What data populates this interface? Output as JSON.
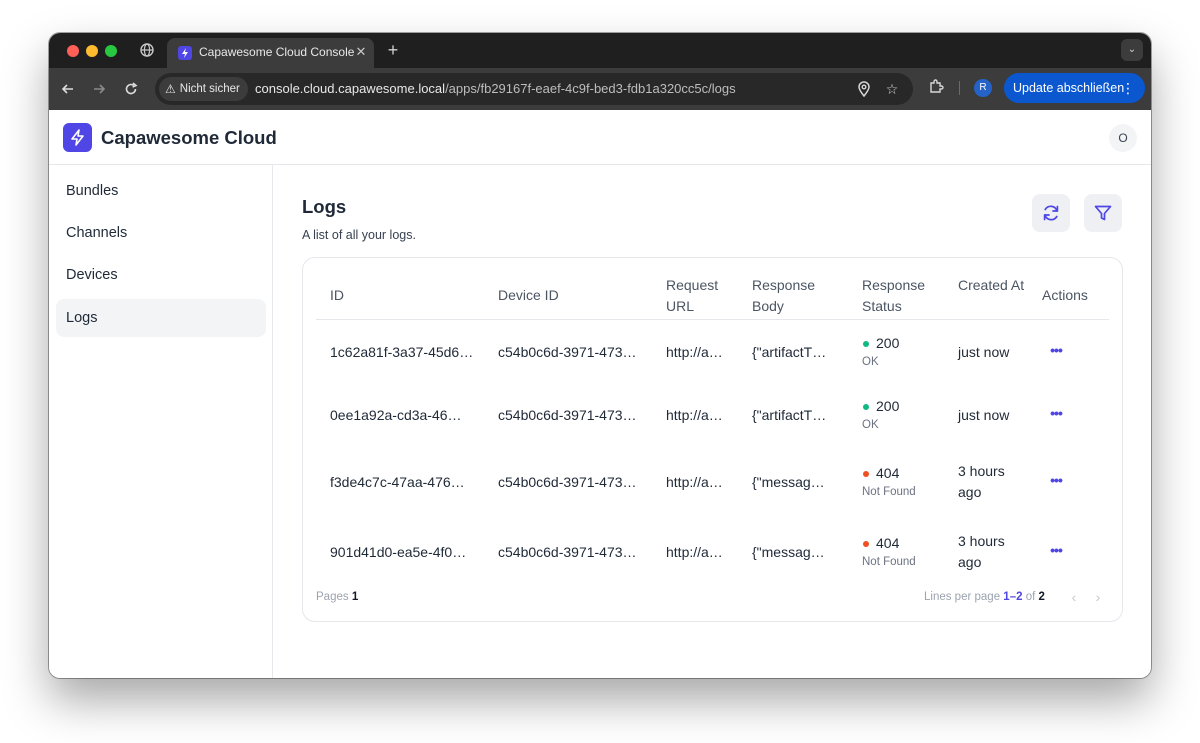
{
  "browser": {
    "tab_title": "Capawesome Cloud Console",
    "security_label": "Nicht sicher",
    "url_host": "console.cloud.capawesome.local",
    "url_path": "/apps/fb29167f-eaef-4c9f-bed3-fdb1a320cc5c/logs",
    "profile_initial": "R",
    "update_label": "Update abschließen",
    "icons": {
      "back": "arrow-left-icon",
      "forward": "arrow-right-icon",
      "reload": "reload-icon",
      "location": "location-pin-icon",
      "bookmark": "star-icon",
      "extensions": "puzzle-icon",
      "menu": "kebab-icon"
    }
  },
  "app": {
    "brand": "Capawesome Cloud",
    "user_initial": "O",
    "accent_color": "#4f46e5"
  },
  "sidebar": {
    "items": [
      {
        "label": "Bundles",
        "active": false
      },
      {
        "label": "Channels",
        "active": false
      },
      {
        "label": "Devices",
        "active": false
      },
      {
        "label": "Logs",
        "active": true
      }
    ]
  },
  "main": {
    "title": "Logs",
    "subtitle": "A list of all your logs."
  },
  "table": {
    "headers": {
      "id": "ID",
      "device_id": "Device ID",
      "request_url": "Request URL",
      "response_body": "Response Body",
      "response_status": "Response Status",
      "created_at": "Created At",
      "actions": "Actions"
    },
    "rows": [
      {
        "id": "1c62a81f-3a37-45d6…",
        "device_id": "c54b0c6d-3971-473…",
        "request_url": "http://a…",
        "response_body": "{\"artifactT…",
        "status_code": "200",
        "status_text": "OK",
        "status_color": "#10b981",
        "created_at": "just now"
      },
      {
        "id": "0ee1a92a-cd3a-46…",
        "device_id": "c54b0c6d-3971-473…",
        "request_url": "http://a…",
        "response_body": "{\"artifactT…",
        "status_code": "200",
        "status_text": "OK",
        "status_color": "#10b981",
        "created_at": "just now"
      },
      {
        "id": "f3de4c7c-47aa-476…",
        "device_id": "c54b0c6d-3971-473…",
        "request_url": "http://a…",
        "response_body": "{\"messag…",
        "status_code": "404",
        "status_text": "Not Found",
        "status_color": "#f04f23",
        "created_at": "3 hours ago"
      },
      {
        "id": "901d41d0-ea5e-4f0…",
        "device_id": "c54b0c6d-3971-473…",
        "request_url": "http://a…",
        "response_body": "{\"messag…",
        "status_code": "404",
        "status_text": "Not Found",
        "status_color": "#f04f23",
        "created_at": "3 hours ago"
      }
    ]
  },
  "footer": {
    "pages_label": "Pages",
    "pages_value": "1",
    "lines_label": "Lines per page",
    "range": "1–2",
    "of_label": "of",
    "total": "2"
  }
}
